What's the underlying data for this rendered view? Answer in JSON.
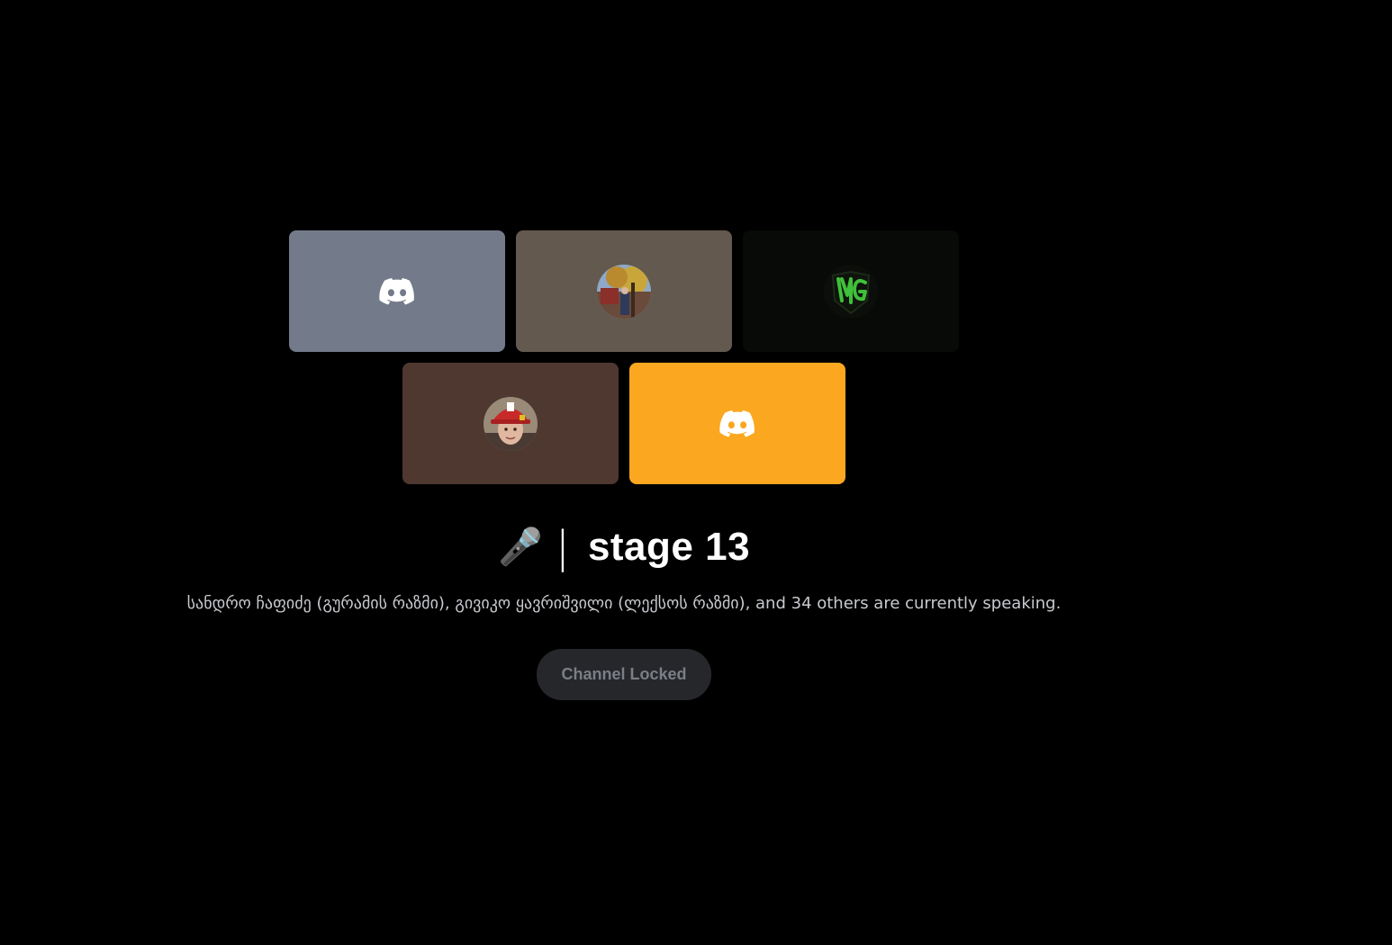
{
  "tiles": [
    {
      "id": "speaker-1",
      "avatar": "discord-logo-icon",
      "background": "#737b8a"
    },
    {
      "id": "speaker-2",
      "avatar": "user-photo-autumn",
      "background": "#63594e"
    },
    {
      "id": "speaker-3",
      "avatar": "mg-logo-icon",
      "background": "#070a06"
    },
    {
      "id": "speaker-4",
      "avatar": "user-photo-helmet",
      "background": "#4e3830"
    },
    {
      "id": "speaker-5",
      "avatar": "discord-logo-icon",
      "background": "#fba720"
    }
  ],
  "channel": {
    "emoji": "🎤",
    "separator": "|",
    "name": "stage 13",
    "speaking_text": "სანდრო ჩაფიძე (გურამის რაზმი), გივიკო ყავრიშვილი (ლექსოს რაზმი), and 34 others are currently speaking."
  },
  "locked_button": {
    "label": "Channel Locked"
  }
}
